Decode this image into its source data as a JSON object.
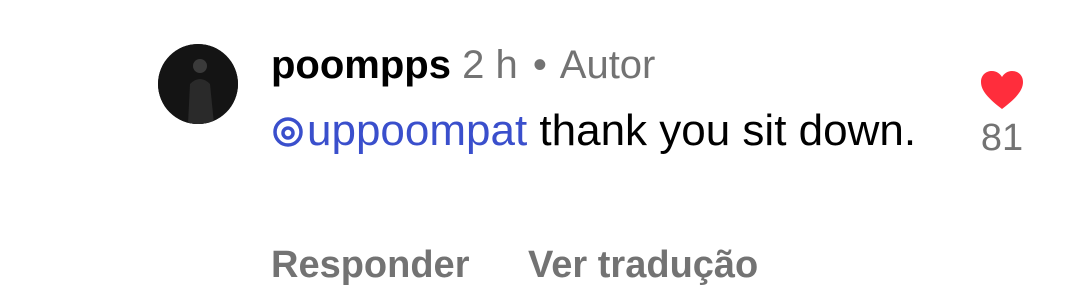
{
  "comment": {
    "username": "poompps",
    "time": "2 h",
    "separator": "•",
    "author_badge": "Autor",
    "mention": "uppoompat",
    "text": " thank you sit down.",
    "reply_label": "Responder",
    "translate_label": "Ver tradução",
    "like_count": "81",
    "avatar_icon": "profile-avatar",
    "mention_icon": "threads-icon",
    "like_icon": "heart-icon"
  },
  "colors": {
    "username": "#000000",
    "secondary_text": "#737373",
    "mention": "#3a4fcc",
    "heart": "#ff2d3c",
    "background": "#ffffff"
  }
}
